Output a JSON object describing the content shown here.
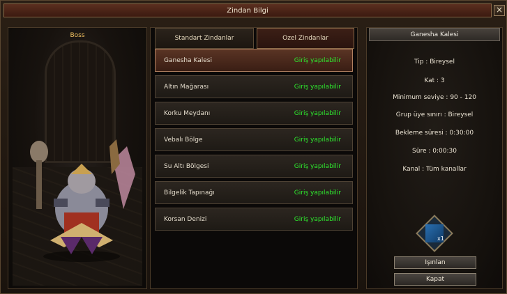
{
  "window": {
    "title": "Zindan Bilgi",
    "close_label": "×"
  },
  "boss_panel": {
    "label": "Boss"
  },
  "tabs": [
    {
      "label": "Standart Zindanlar",
      "active": false
    },
    {
      "label": "Ozel Zindanlar",
      "active": true
    }
  ],
  "dungeons": [
    {
      "name": "Ganesha Kalesi",
      "status": "Giriş yapılabilir",
      "selected": true
    },
    {
      "name": "Altın Mağarası",
      "status": "Giriş yapılabilir",
      "selected": false
    },
    {
      "name": "Korku Meydanı",
      "status": "Giriş yapılabilir",
      "selected": false
    },
    {
      "name": "Vebalı Bölge",
      "status": "Giriş yapılabilir",
      "selected": false
    },
    {
      "name": "Su Altı Bölgesi",
      "status": "Giriş yapılabilir",
      "selected": false
    },
    {
      "name": "Bilgelik Tapınağı",
      "status": "Giriş yapılabilir",
      "selected": false
    },
    {
      "name": "Korsan Denizi",
      "status": "Giriş yapılabilir",
      "selected": false
    }
  ],
  "details": {
    "title": "Ganesha Kalesi",
    "tip": "Tip : Bireysel",
    "kat": "Kat : 3",
    "min_level": "Minimum seviye : 90 - 120",
    "group_limit": "Grup üye sınırı : Bireysel",
    "cooldown": "Bekleme süresi : 0:30:00",
    "duration": "Süre : 0:00:30",
    "channel": "Kanal : Tüm kanallar",
    "required_item": {
      "icon": "scroll-icon",
      "count": "x1"
    }
  },
  "buttons": {
    "teleport": "Işınlan",
    "close": "Kapat"
  },
  "colors": {
    "status_green": "#2ee82e",
    "boss_label": "#f0c060",
    "selected_row": "#5a3424"
  }
}
